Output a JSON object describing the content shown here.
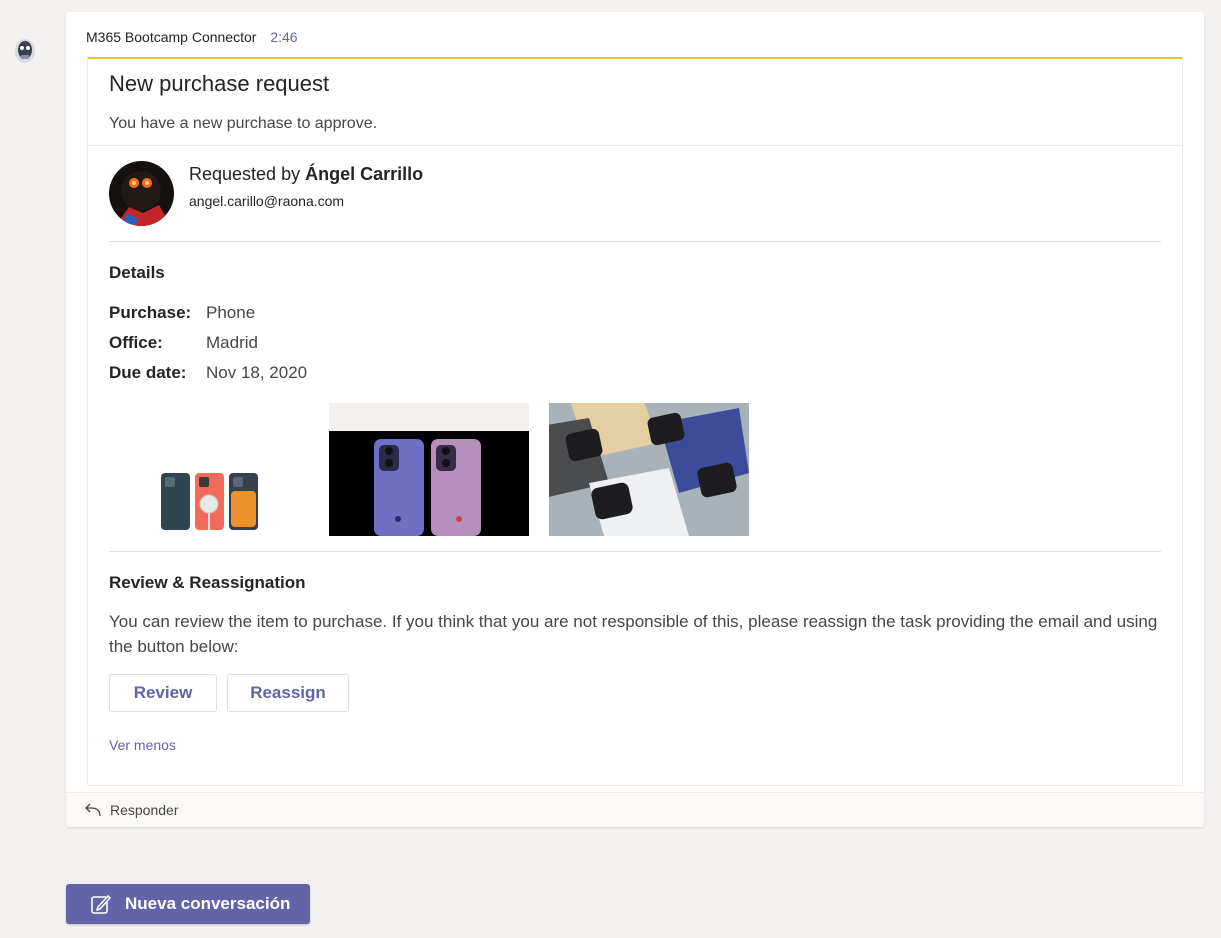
{
  "message": {
    "sender": "M365 Bootcamp Connector",
    "time": "2:46"
  },
  "card": {
    "title": "New purchase request",
    "subtitle": "You have a new purchase to approve.",
    "requester": {
      "prefix": "Requested by ",
      "name": "Ángel Carrillo",
      "email": "angel.carillo@raona.com"
    },
    "details": {
      "heading": "Details",
      "facts": [
        {
          "label": "Purchase:",
          "value": "Phone"
        },
        {
          "label": "Office:",
          "value": "Madrid"
        },
        {
          "label": "Due date:",
          "value": "Nov 18, 2020"
        }
      ]
    },
    "images": [
      "phone-cases-image",
      "purple-phones-image",
      "phones-grid-image"
    ],
    "review": {
      "heading": "Review & Reassignation",
      "text": "You can review the item to purchase. If you think that you are not responsible of this, please reassign the task providing the email and using the button below:",
      "buttons": {
        "review": "Review",
        "reassign": "Reassign"
      }
    },
    "see_less": "Ver menos"
  },
  "reply": {
    "label": "Responder",
    "icon": "reply-icon"
  },
  "new_conversation": {
    "label": "Nueva conversación",
    "icon": "compose-icon"
  },
  "colors": {
    "accent": "#6264a7",
    "card_top": "#e8c32b",
    "background": "#f3f2f1"
  }
}
